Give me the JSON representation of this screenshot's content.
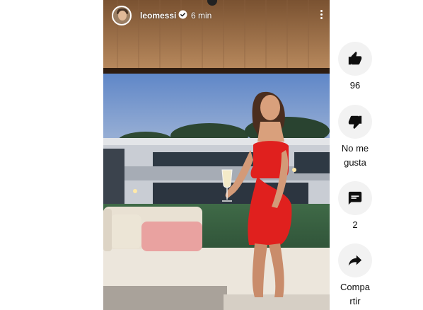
{
  "story": {
    "username": "leomessi",
    "time": "6 min"
  },
  "actions": {
    "like_count": "96",
    "dislike_line1": "No me",
    "dislike_line2": "gusta",
    "comment_count": "2",
    "share_line1": "Compa",
    "share_line2": "rtir"
  },
  "icons": {
    "like": "thumb-up-icon",
    "dislike": "thumb-down-icon",
    "comment": "comment-icon",
    "share": "share-arrow-icon",
    "verified": "verified-badge-icon",
    "more": "more-vertical-icon"
  },
  "colors": {
    "button_bg": "#f2f2f2",
    "icon": "#0f0f0f",
    "dress": "#e0201e"
  }
}
